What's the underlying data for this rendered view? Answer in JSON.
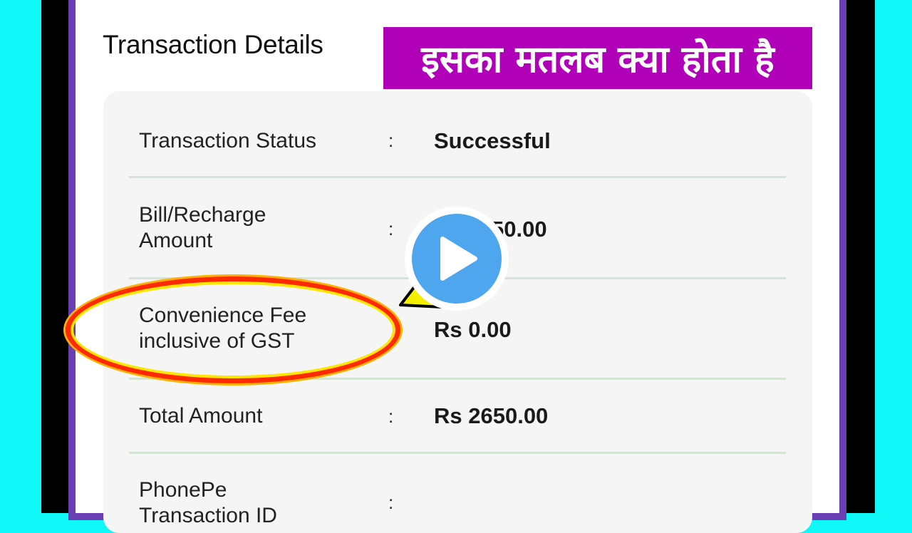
{
  "page_title": "Transaction Details",
  "banner_text": "इसका मतलब क्या होता है",
  "colors": {
    "outer_background": "#0ff7f7",
    "frame": "#6a3fb4",
    "banner": "#b000b8",
    "highlight": "#ff2a00",
    "play_button": "#4da6ee"
  },
  "rows": [
    {
      "label": "Transaction Status",
      "value": "Successful"
    },
    {
      "label": "Bill/Recharge Amount",
      "label_lines": [
        "Bill/Recharge",
        "Amount"
      ],
      "value": "50.00"
    },
    {
      "label": "Convenience Fee inclusive of GST",
      "label_lines": [
        "Convenience Fee",
        "inclusive of GST"
      ],
      "value": "Rs 0.00"
    },
    {
      "label": "Total Amount",
      "value": "Rs 2650.00"
    },
    {
      "label": "PhonePe Transaction ID",
      "label_lines": [
        "PhonePe",
        "Transaction ID"
      ],
      "value": ""
    }
  ],
  "colon": ":",
  "icons": {
    "play": "play-icon",
    "pointer": "pointer-arrow-icon"
  }
}
